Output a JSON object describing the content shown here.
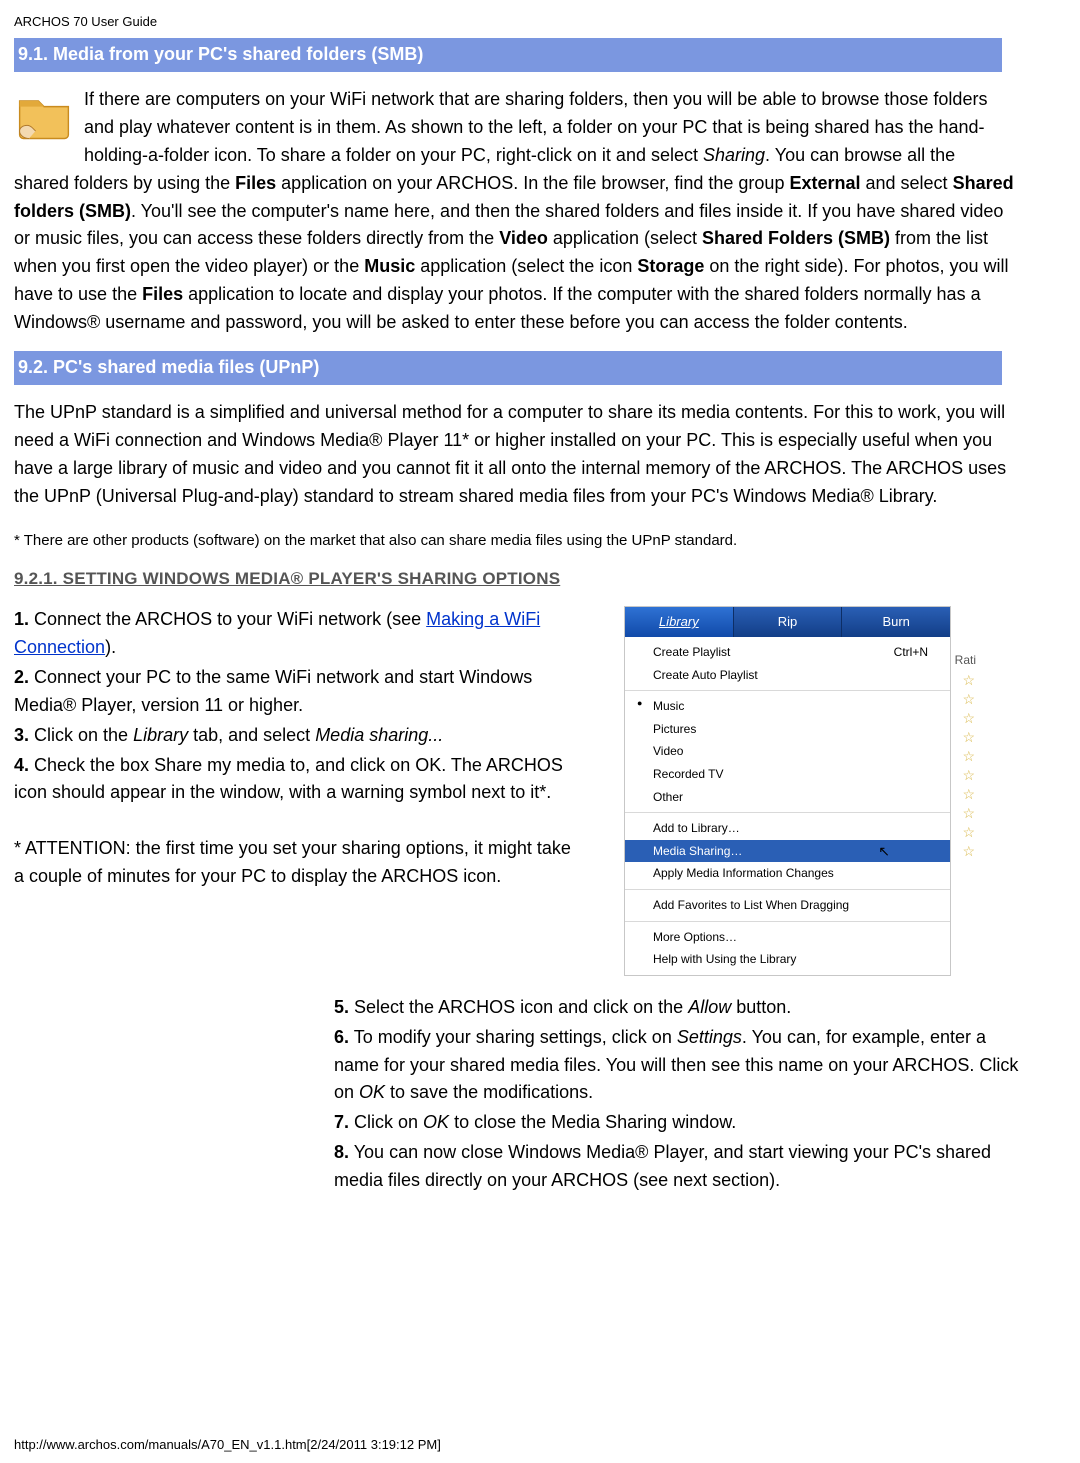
{
  "header": "ARCHOS 70 User Guide",
  "section91": {
    "title": "9.1. Media from your PC's shared folders (SMB)"
  },
  "para91": {
    "t1": "If there are computers on your WiFi network that are sharing folders, then you will be able to browse those folders and play whatever content is in them.  As shown to the left, a folder on your PC that is being shared has the hand-holding-a-folder icon.  To share a folder on your PC, right-click on it and select ",
    "i1": "Sharing",
    "t2": ". You can browse all the shared folders by using the ",
    "b1": "Files",
    "t3": " application on your ARCHOS. In the file browser, find the group ",
    "b2": "External",
    "t4": " and select ",
    "b3": "Shared folders (SMB)",
    "t5": ". You'll see the computer's name here, and then the shared folders and files inside it.  If you have shared video or music files, you can access these folders directly from the ",
    "b4": "Video",
    "t6": " application (select ",
    "b5": "Shared Folders (SMB)",
    "t7": " from the list when you first open the video player) or the ",
    "b6": "Music",
    "t8": " application (select the icon ",
    "b7": "Storage",
    "t9": " on the right side). For photos, you will have to use the ",
    "b8": "Files",
    "t10": " application to locate and display your photos. If the computer with the shared folders normally has a Windows® username and password, you will be asked to enter these before you can access the folder contents."
  },
  "section92": {
    "title": "9.2. PC's shared media files (UPnP)"
  },
  "para92": "The UPnP standard is a simplified and universal method for a computer to share its media contents.  For this to work, you will need a WiFi connection and Windows Media® Player 11* or higher installed on your PC. This is especially useful when you have a large library of music and video and you cannot fit it all onto the internal memory of the ARCHOS. The ARCHOS uses the UPnP (Universal Plug-and-play) standard to stream shared media files from your PC's Windows Media® Library.",
  "note92": "* There are other products (software) on the market that also can share media files using the UPnP standard.",
  "sub921": "9.2.1. SETTING WINDOWS MEDIA® PLAYER'S SHARING OPTIONS",
  "steps": {
    "s1a": "1.",
    "s1b": " Connect the ARCHOS to your WiFi network (see ",
    "s1link": "Making a WiFi Connection",
    "s1c": ").",
    "s2a": "2.",
    "s2b": " Connect your PC to the same WiFi network and start Windows Media® Player, version 11 or higher.",
    "s3a": "3.",
    "s3b": " Click on the ",
    "s3i1": "Library",
    "s3c": " tab, and select ",
    "s3i2": "Media sharing...",
    "s4a": "4.",
    "s4b": " Check the box Share my media to, and click on OK. The ARCHOS icon should appear in the window, with a warning symbol next to it*.",
    "attn": "* ATTENTION: the first time you set your sharing options, it might take a couple of minutes for your PC to display the ARCHOS icon.",
    "s5a": "5.",
    "s5b": " Select the ARCHOS icon and click on the ",
    "s5i": "Allow",
    "s5c": " button.",
    "s6a": "6.",
    "s6b": " To modify your sharing settings, click on ",
    "s6i1": "Settings",
    "s6c": ". You can, for example, enter a name for your shared media files. You will then see this name on your ARCHOS. Click on ",
    "s6i2": "OK",
    "s6d": " to save the modifications.",
    "s7a": "7.",
    "s7b": " Click on ",
    "s7i": "OK",
    "s7c": " to close the Media Sharing window.",
    "s8a": "8.",
    "s8b": " You can now close Windows Media® Player, and start viewing your PC's shared media files directly on your ARCHOS (see next section)."
  },
  "wmp": {
    "tabs": {
      "library": "Library",
      "rip": "Rip",
      "burn": "Burn"
    },
    "createPlaylist": "Create Playlist",
    "createPlaylistShortcut": "Ctrl+N",
    "createAuto": "Create Auto Playlist",
    "music": "Music",
    "pictures": "Pictures",
    "video": "Video",
    "recorded": "Recorded TV",
    "other": "Other",
    "addLib": "Add to Library…",
    "mediaSharing": "Media Sharing…",
    "applyInfo": "Apply Media Information Changes",
    "addFav": "Add Favorites to List When Dragging",
    "moreOpt": "More Options…",
    "help": "Help with Using the Library",
    "rating": "Rati"
  },
  "footer": "http://www.archos.com/manuals/A70_EN_v1.1.htm[2/24/2011 3:19:12 PM]"
}
